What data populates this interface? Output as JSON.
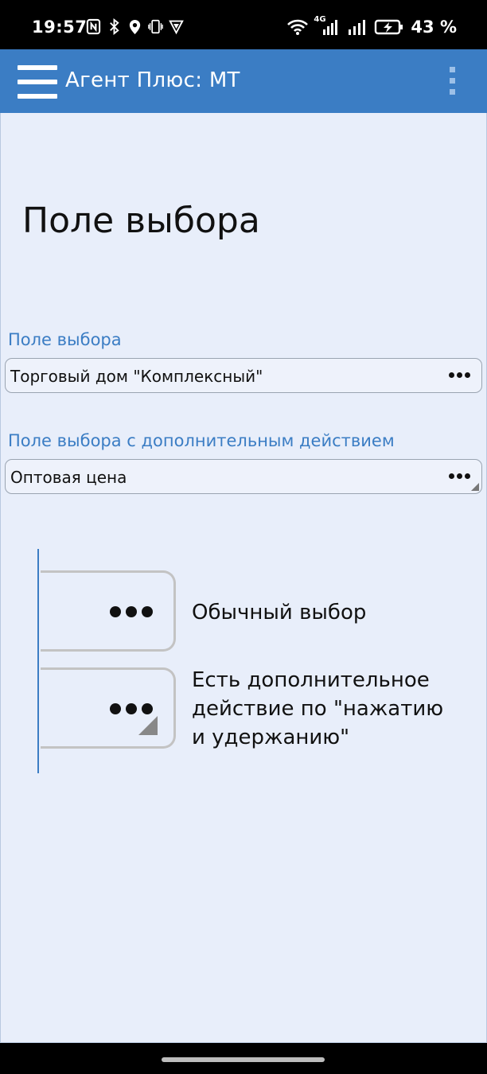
{
  "status_bar": {
    "time": "19:57",
    "battery_percent": "43 %",
    "network_label": "4G",
    "left_icons": [
      "nfc-icon",
      "bluetooth-icon",
      "location-icon",
      "vibrate-icon",
      "vpn-shield-icon"
    ],
    "right_icons": [
      "wifi-icon",
      "signal-icon",
      "signal-icon",
      "battery-charging-icon"
    ]
  },
  "app_bar": {
    "title": "Агент Плюс: МТ",
    "menu_icon": "hamburger-menu-icon",
    "more_icon": "more-vertical-icon",
    "color": "#3b7dc4"
  },
  "page": {
    "title": "Поле выбора"
  },
  "fields": [
    {
      "label": "Поле выбора",
      "value": "Торговый дом \"Комплексный\"",
      "has_extra_action": false
    },
    {
      "label": "Поле выбора с дополнительным действием",
      "value": "Оптовая цена",
      "has_extra_action": true
    }
  ],
  "legend": [
    {
      "text": "Обычный выбор"
    },
    {
      "text": "Есть дополнительное действие по \"нажатию и удержанию\""
    }
  ],
  "colors": {
    "accent": "#3b7dc4",
    "background": "#e8eefa"
  }
}
